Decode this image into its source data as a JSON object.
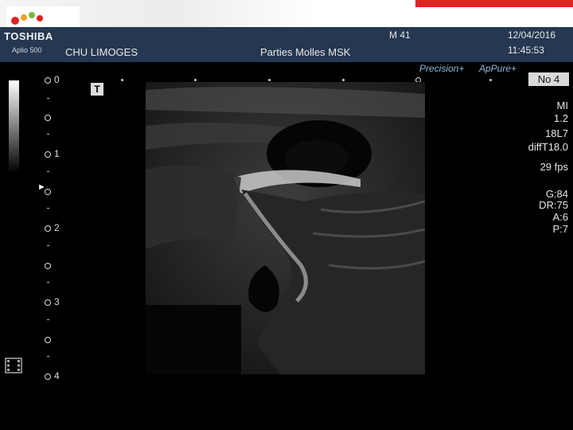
{
  "header": {
    "brand": "TOSHIBA",
    "model": "Aplio 500",
    "hospital": "CHU LIMOGES",
    "preset": "Parties Molles MSK",
    "exam_number": "M 41",
    "date": "12/04/2016",
    "time": "11:45:53"
  },
  "modes": {
    "precision": "Precision+",
    "apure": "ApPure+"
  },
  "body_mark": "T",
  "depth_scale": {
    "labels": [
      "0",
      "1",
      "2",
      "3",
      "4"
    ]
  },
  "panel": {
    "image_number": "No 4",
    "mi_label": "MI",
    "mi_value": "1.2",
    "probe": "18L7",
    "freq": "diffT18.0",
    "fps": "29 fps",
    "gain": "G:84",
    "dynamic_range": "DR:75",
    "a": "A:6",
    "p": "P:7"
  },
  "colors": {
    "header_bg": "#253751",
    "accent_red": "#e32222",
    "mode_text": "#8fb8e0"
  }
}
